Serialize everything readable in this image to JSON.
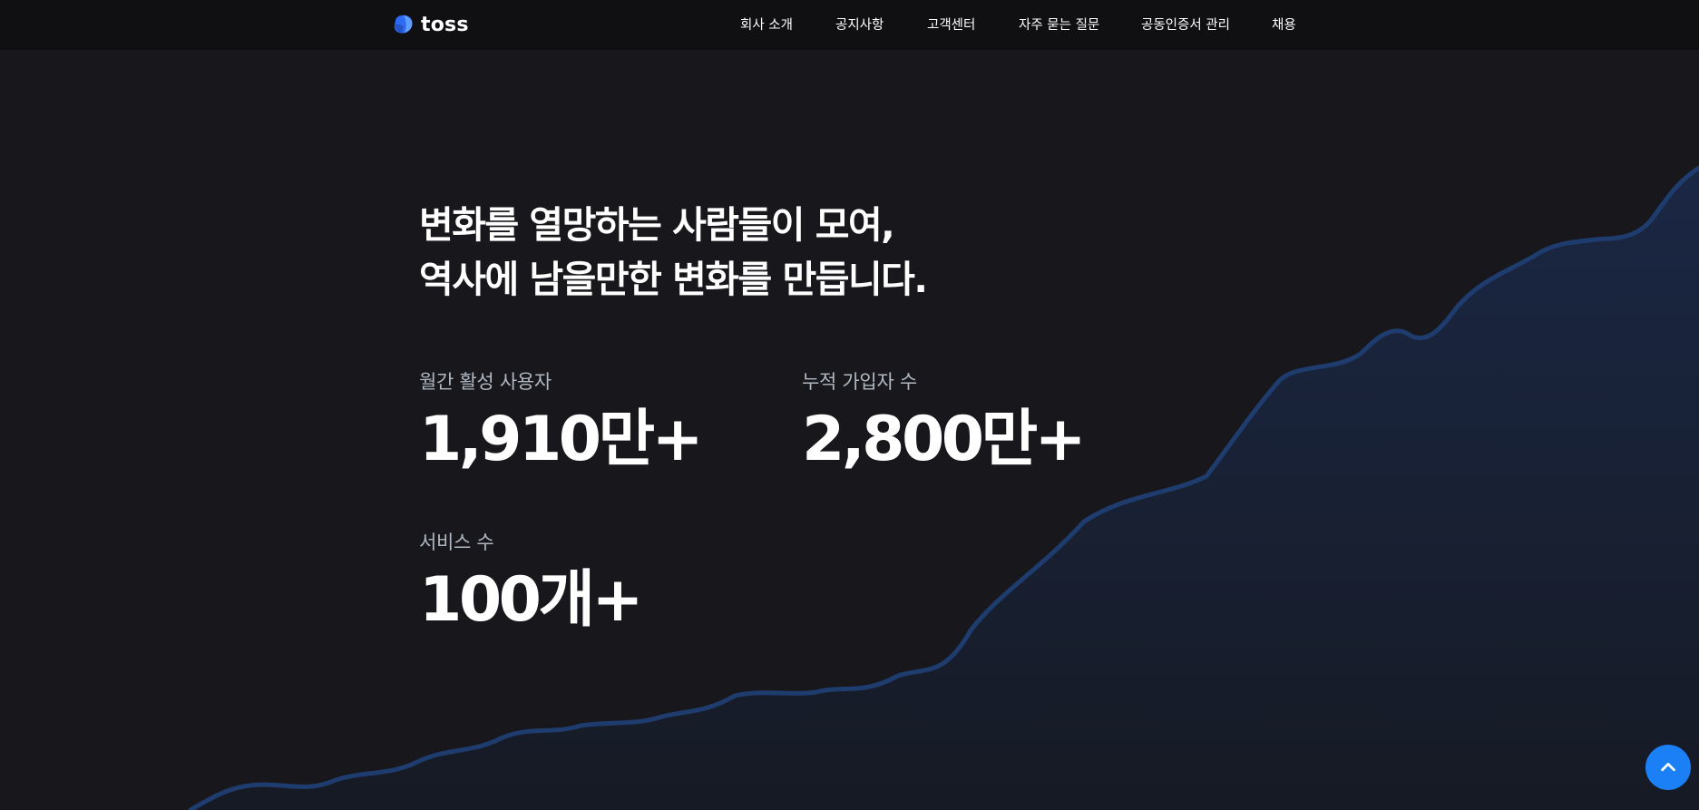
{
  "header": {
    "logo_text": "toss",
    "nav": [
      "회사 소개",
      "공지사항",
      "고객센터",
      "자주 묻는 질문",
      "공동인증서 관리",
      "채용"
    ]
  },
  "hero": {
    "headline_line1": "변화를 열망하는 사람들이 모여,",
    "headline_line2": "역사에 남을만한 변화를 만듭니다.",
    "stats": [
      {
        "label": "월간 활성 사용자",
        "value": "1,910만+"
      },
      {
        "label": "누적 가입자 수",
        "value": "2,800만+"
      },
      {
        "label": "서비스 수",
        "value": "100개+"
      }
    ]
  },
  "icons": {
    "logo": "toss-logo-icon",
    "top_button": "chevron-up-icon"
  },
  "colors": {
    "background": "#17171c",
    "header_background": "#101013",
    "chart_line": "#1e3d6e",
    "chart_fill": "#18213a",
    "accent": "#1b7ff6"
  }
}
